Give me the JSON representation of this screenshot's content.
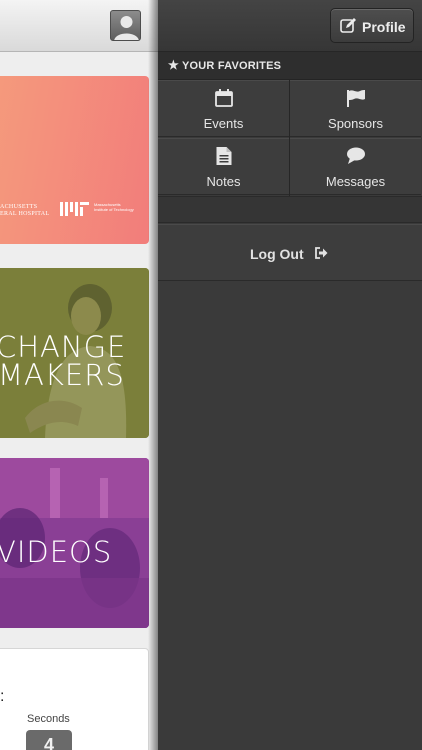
{
  "main": {
    "hospital_card": {
      "hospital_name": "MASSACHUSETTS GENERAL HOSPITAL",
      "hospital_visible": "ACHUSETTS\nERAL HOSPITAL",
      "mit_name": "Massachusetts Institute of Technology"
    },
    "changemakers_card": {
      "line1": "CHANGE",
      "line2": "MAKERS"
    },
    "videos_card": {
      "text": "VIDEOS"
    },
    "countdown": {
      "colon": ":",
      "seconds_label": "Seconds",
      "seconds_value": "4"
    },
    "colors": {
      "hospital_card": "#f48a7b",
      "changemakers_card": "#7b7f3a",
      "videos_card": "#8c3f96"
    }
  },
  "menu": {
    "profile_button": {
      "label": "Profile",
      "icon": "edit-icon"
    },
    "favorites_header": {
      "label": "YOUR FAVORITES",
      "icon": "star-icon"
    },
    "favorites": [
      {
        "label": "Events",
        "icon": "calendar-icon"
      },
      {
        "label": "Sponsors",
        "icon": "flag-icon"
      },
      {
        "label": "Notes",
        "icon": "document-icon"
      },
      {
        "label": "Messages",
        "icon": "chat-bubble-icon"
      }
    ],
    "logout": {
      "label": "Log Out",
      "icon": "sign-out-icon"
    },
    "colors": {
      "background": "#3a3a3a",
      "cell": "#3d3d3d",
      "text": "#e6e6e6"
    }
  }
}
